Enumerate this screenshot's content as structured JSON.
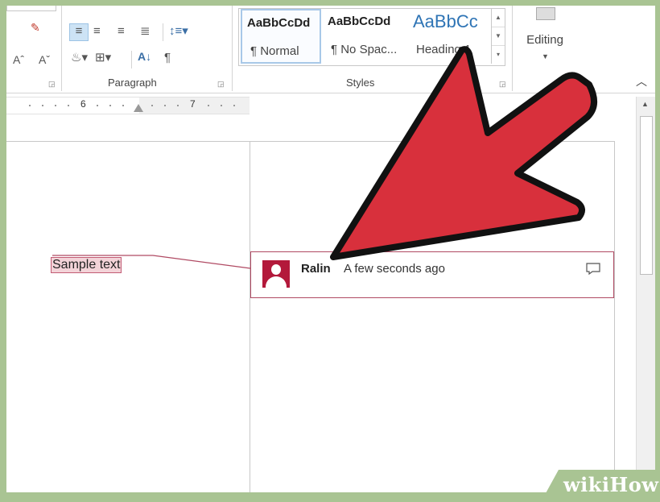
{
  "ribbon": {
    "paragraph_group_label": "Paragraph",
    "styles_group_label": "Styles",
    "styles": [
      {
        "sample": "AaBbCcDd",
        "name": "¶ Normal"
      },
      {
        "sample": "AaBbCcDd",
        "name": "¶ No Spac..."
      },
      {
        "sample": "AaBbCc",
        "name": "Heading 1"
      }
    ],
    "editing_label": "Editing"
  },
  "ruler": {
    "marks": [
      "6",
      "7"
    ]
  },
  "document": {
    "sample_text": "Sample text",
    "comment": {
      "author": "Ralin",
      "time": "A few seconds ago"
    }
  },
  "watermark": {
    "wiki": "wiki",
    "how": "How"
  },
  "colors": {
    "arrow_fill": "#d8303c",
    "comment_accent": "#b3193b",
    "frame_green": "#a9c493",
    "heading_blue": "#2e74b5"
  }
}
